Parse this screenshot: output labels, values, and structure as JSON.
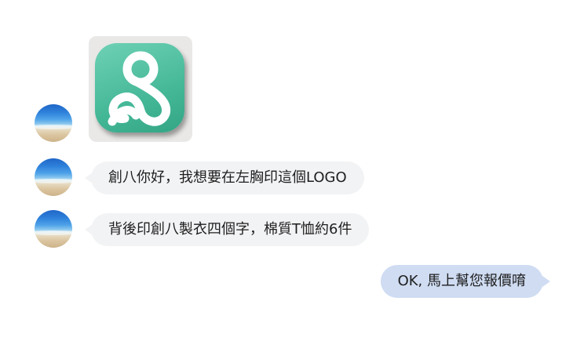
{
  "chat": {
    "messages": [
      {
        "sender": "customer",
        "type": "image",
        "image_icon": "logo-image"
      },
      {
        "sender": "customer",
        "type": "text",
        "text": "創八你好，我想要在左胸印這個LOGO"
      },
      {
        "sender": "customer",
        "type": "text",
        "text": "背後印創八製衣四個字，棉質T恤約6件"
      },
      {
        "sender": "shop",
        "type": "text",
        "text": "OK, 馬上幫您報價唷"
      }
    ]
  },
  "colors": {
    "incoming_bubble": "#f2f3f5",
    "outgoing_bubble": "#cfdcf2",
    "logo_green": "#45b898"
  }
}
